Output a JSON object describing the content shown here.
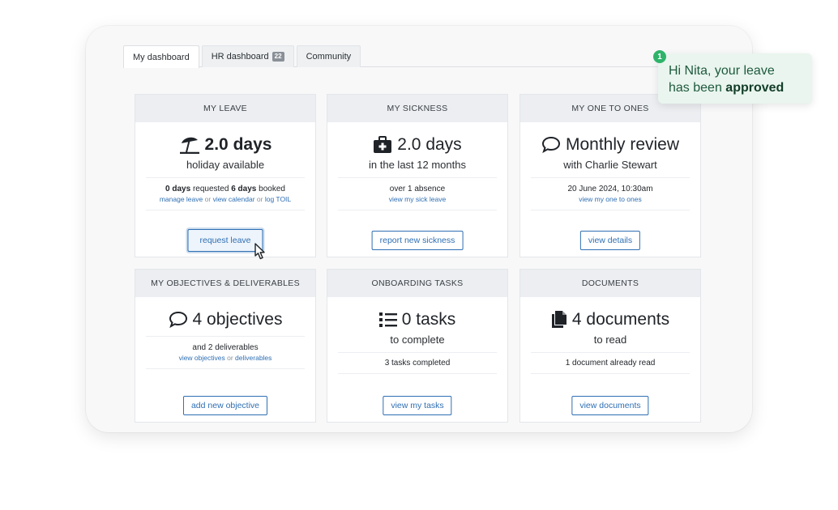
{
  "tabs": [
    {
      "label": "My dashboard",
      "active": true
    },
    {
      "label": "HR dashboard",
      "badge": "22"
    },
    {
      "label": "Community"
    }
  ],
  "toast": {
    "number": "1",
    "line1": "Hi Nita, your leave",
    "line2_prefix": "has been",
    "line2_bold": "approved"
  },
  "cards": {
    "leave": {
      "title": "MY LEAVE",
      "icon": "beach-umbrella-icon",
      "big": "2.0 days",
      "sub": "holiday available",
      "detail_requested_b": "0 days",
      "detail_requested": "requested",
      "detail_booked_b": "6 days",
      "detail_booked": "booked",
      "link1": "manage leave",
      "or1": "or",
      "link2": "view calendar",
      "or2": "or",
      "link3": "log TOIL",
      "button": "request leave"
    },
    "sickness": {
      "title": "MY SICKNESS",
      "icon": "medical-kit-icon",
      "big": "2.0 days",
      "sub": "in the last 12 months",
      "detail": "over 1 absence",
      "link1": "view my sick leave",
      "button": "report new sickness"
    },
    "one_to_ones": {
      "title": "MY ONE TO ONES",
      "icon": "speech-bubble-icon",
      "big": "Monthly review",
      "sub": "with Charlie Stewart",
      "detail": "20 June 2024, 10:30am",
      "link1": "view my one to ones",
      "button": "view details"
    },
    "objectives": {
      "title": "MY OBJECTIVES & DELIVERABLES",
      "icon": "speech-bubble-icon",
      "big": "4 objectives",
      "detail": "and 2 deliverables",
      "link1": "view objectives",
      "or1": "or",
      "link2": "deliverables",
      "button": "add new objective"
    },
    "onboarding": {
      "title": "ONBOARDING TASKS",
      "icon": "list-icon",
      "big": "0 tasks",
      "sub": "to complete",
      "detail": "3 tasks completed",
      "button": "view my tasks"
    },
    "documents": {
      "title": "DOCUMENTS",
      "icon": "documents-icon",
      "big": "4 documents",
      "sub": "to read",
      "detail": "1 document already read",
      "button": "view documents"
    }
  },
  "colors": {
    "accent": "#2f6fb3",
    "toast_bg": "#e9f5ee",
    "toast_badge": "#2fb36b",
    "card_header": "#eceef1"
  }
}
